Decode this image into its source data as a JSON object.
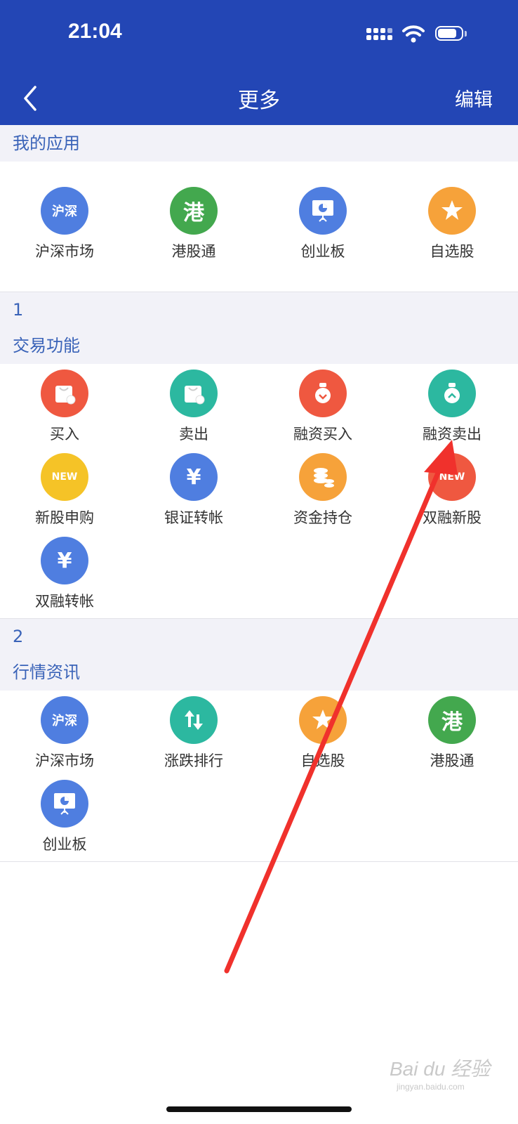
{
  "status_bar": {
    "time": "21:04"
  },
  "nav": {
    "title": "更多",
    "edit_label": "编辑"
  },
  "my_apps": {
    "title": "我的应用",
    "items": [
      {
        "label": "沪深市场",
        "icon": "hushen-market-icon",
        "icon_text": "沪深",
        "color": "#4f7ee0"
      },
      {
        "label": "港股通",
        "icon": "hk-connect-icon",
        "icon_text": "港",
        "color": "#43a84e"
      },
      {
        "label": "创业板",
        "icon": "growth-board-icon",
        "icon_text": "",
        "color": "#4f7ee0"
      },
      {
        "label": "自选股",
        "icon": "star-icon",
        "icon_text": "★",
        "color": "#f6a23a"
      }
    ]
  },
  "group1": {
    "number": "1",
    "title": "交易功能",
    "items": [
      {
        "label": "买入",
        "icon": "buy-bag-icon",
        "icon_text": "",
        "color": "#ef5840"
      },
      {
        "label": "卖出",
        "icon": "sell-bag-icon",
        "icon_text": "",
        "color": "#2cb8a0"
      },
      {
        "label": "融资买入",
        "icon": "margin-buy-icon",
        "icon_text": "",
        "color": "#ef5840"
      },
      {
        "label": "融资卖出",
        "icon": "margin-sell-icon",
        "icon_text": "",
        "color": "#2cb8a0"
      },
      {
        "label": "新股申购",
        "icon": "ipo-subscribe-icon",
        "icon_text": "NEW",
        "color": "#f5c327"
      },
      {
        "label": "银证转帐",
        "icon": "bank-transfer-icon",
        "icon_text": "¥",
        "color": "#4f7ee0"
      },
      {
        "label": "资金持仓",
        "icon": "funds-position-icon",
        "icon_text": "",
        "color": "#f6a23a"
      },
      {
        "label": "双融新股",
        "icon": "margin-ipo-icon",
        "icon_text": "NEW",
        "color": "#ef5840"
      },
      {
        "label": "双融转帐",
        "icon": "margin-transfer-icon",
        "icon_text": "¥",
        "color": "#4f7ee0"
      }
    ]
  },
  "group2": {
    "number": "2",
    "title": "行情资讯",
    "items": [
      {
        "label": "沪深市场",
        "icon": "hushen-market-icon",
        "icon_text": "沪深",
        "color": "#4f7ee0"
      },
      {
        "label": "涨跌排行",
        "icon": "rank-updown-icon",
        "icon_text": "",
        "color": "#2cb8a0"
      },
      {
        "label": "自选股",
        "icon": "star-icon",
        "icon_text": "★",
        "color": "#f6a23a"
      },
      {
        "label": "港股通",
        "icon": "hk-connect-icon",
        "icon_text": "港",
        "color": "#43a84e"
      },
      {
        "label": "创业板",
        "icon": "growth-board-icon",
        "icon_text": "",
        "color": "#4f7ee0"
      }
    ]
  },
  "watermark": {
    "main": "Bai du 经验",
    "sub": "jingyan.baidu.com"
  },
  "colors": {
    "header": "#2346b5",
    "section_text": "#3a63b8",
    "annotation_arrow": "#f0312c"
  }
}
